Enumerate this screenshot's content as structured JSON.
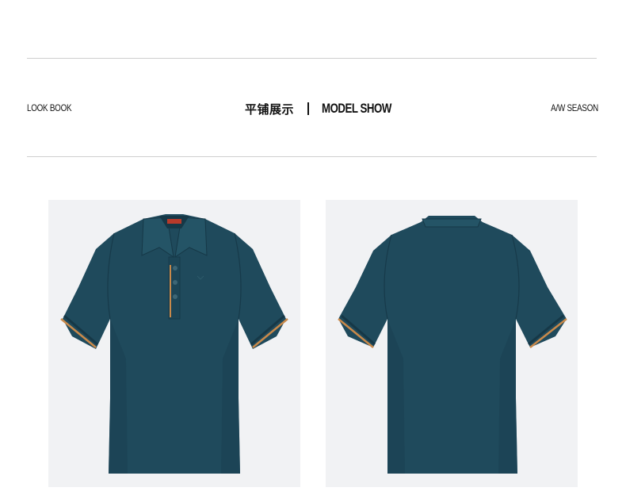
{
  "header": {
    "left_label": "LOOK BOOK",
    "center_cn": "平铺展示",
    "center_en": "MODEL SHOW",
    "right_label": "A/W SEASON"
  },
  "images": [
    {
      "view": "front",
      "subject": "polo-shirt-front",
      "color": "#1f4a5c",
      "trim_color": "#c9894a"
    },
    {
      "view": "back",
      "subject": "polo-shirt-back",
      "color": "#1f4a5c",
      "trim_color": "#c9894a"
    }
  ],
  "colors": {
    "background": "#ffffff",
    "panel": "#f1f2f4",
    "rule": "#cfcfcf",
    "shirt": "#1f4a5c",
    "trim": "#c9894a"
  }
}
